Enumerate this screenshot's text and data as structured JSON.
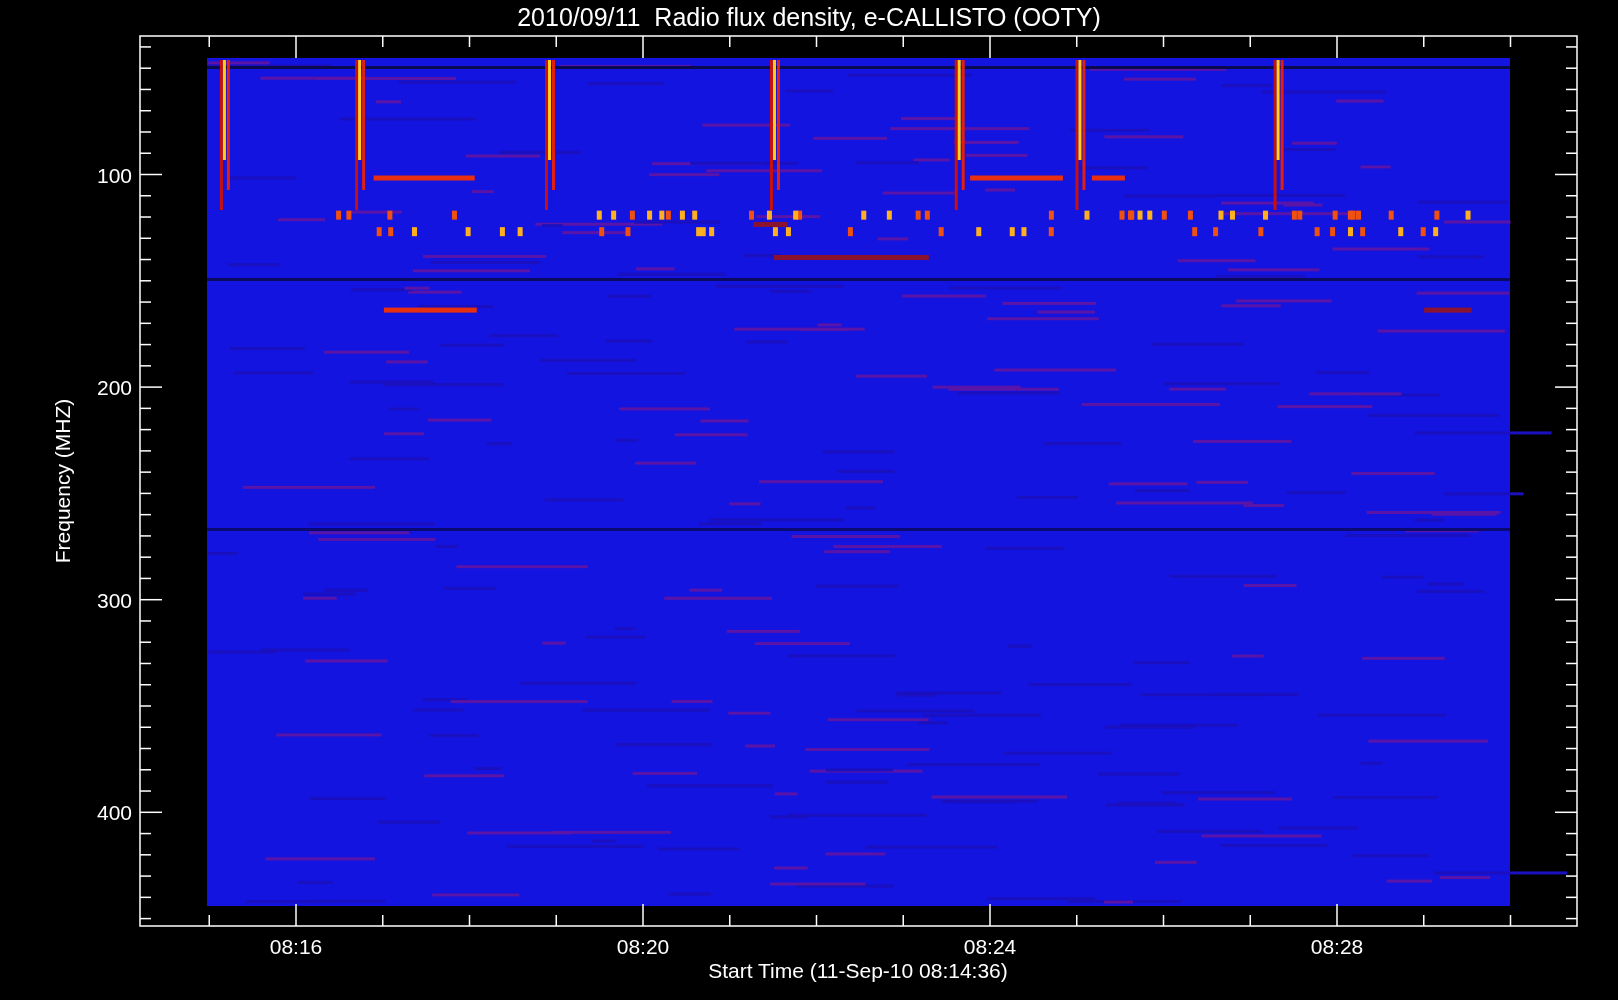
{
  "title": "2010/09/11  Radio flux density, e-CALLISTO (OOTY)",
  "y_axis": {
    "label": "Frequency (MHZ)",
    "ticks": [
      "100",
      "200",
      "300",
      "400"
    ]
  },
  "x_axis": {
    "label": "Start Time (11-Sep-10 08:14:36)",
    "ticks": [
      "08:16",
      "08:20",
      "08:24",
      "08:28"
    ]
  }
}
